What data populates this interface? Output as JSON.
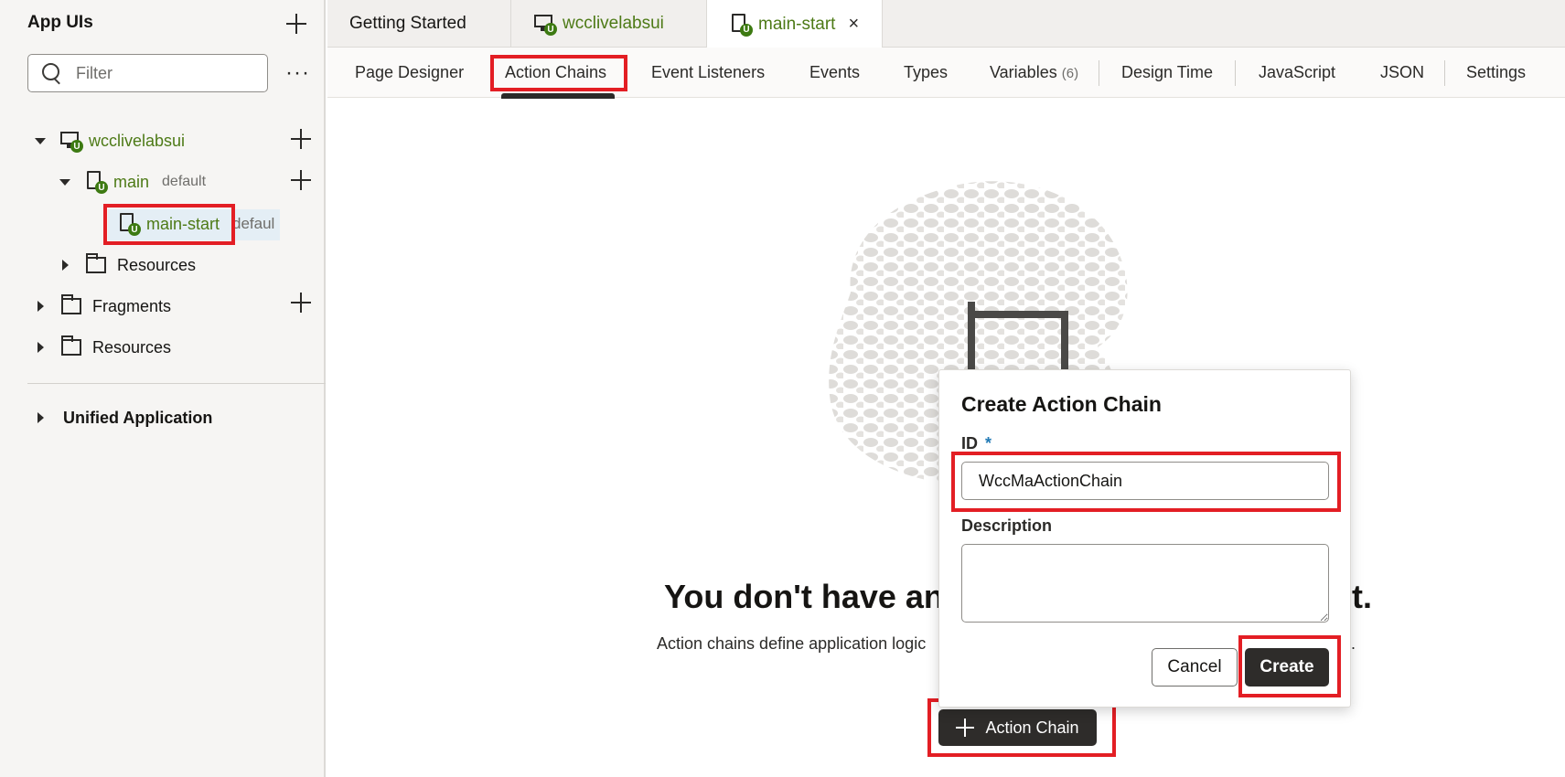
{
  "sidebar": {
    "title": "App UIs",
    "filter_placeholder": "Filter",
    "tree": {
      "app": "wcclivelabsui",
      "main": "main",
      "main_badge": "default",
      "main_start": "main-start",
      "main_start_badge": "defaul",
      "resources_inner": "Resources",
      "fragments": "Fragments",
      "resources": "Resources"
    },
    "section": "Unified Application"
  },
  "tabs": [
    {
      "label": "Getting Started"
    },
    {
      "label": "wcclivelabsui"
    },
    {
      "label": "main-start"
    }
  ],
  "subnav": {
    "page_designer": "Page Designer",
    "action_chains": "Action Chains",
    "event_listeners": "Event Listeners",
    "events": "Events",
    "types": "Types",
    "variables": "Variables",
    "variables_count": "(6)",
    "design_time": "Design Time",
    "javascript": "JavaScript",
    "json": "JSON",
    "settings": "Settings"
  },
  "empty_state": {
    "title_start": "You don't have an",
    "title_end": "t.",
    "desc_start": "Action chains define application logic",
    "desc_end": "nts.",
    "add_button": "Action Chain"
  },
  "dialog": {
    "title": "Create Action Chain",
    "id_label": "ID",
    "required_mark": "*",
    "id_value": "WccMaActionChain",
    "description_label": "Description",
    "cancel": "Cancel",
    "create": "Create"
  },
  "colors": {
    "highlight": "#e31e24",
    "green": "#4d7a16",
    "dark_button": "#2e2c2a"
  }
}
